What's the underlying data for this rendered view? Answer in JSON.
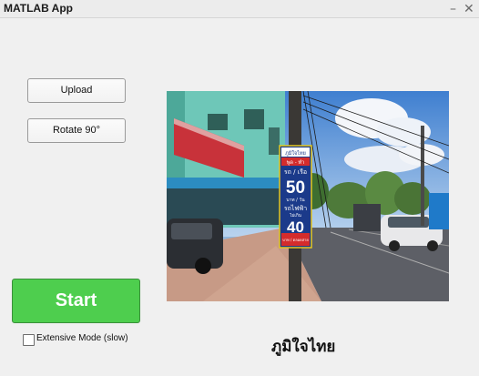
{
  "window": {
    "title": "MATLAB App",
    "minimize_glyph": "–",
    "close_glyph": "✕"
  },
  "controls": {
    "upload_label": "Upload",
    "rotate_label": "Rotate 90°",
    "start_label": "Start",
    "start_color": "#4ece4e",
    "extensive_mode_label": "Extensive Mode (slow)",
    "extensive_mode_checked": false
  },
  "photo": {
    "sign": {
      "line1": "ภูมิใจไทย",
      "line2": "พูด - ทำ",
      "line3": "รถ / เรือ",
      "line4": "50",
      "line5": "บาท / วัน",
      "line6": "รถไฟฟ้า",
      "line7": "ไม่เกิน",
      "line8": "40",
      "line9": "บาท / ตลอดสาย"
    }
  },
  "result": {
    "text": "ภูมิใจไทย"
  }
}
